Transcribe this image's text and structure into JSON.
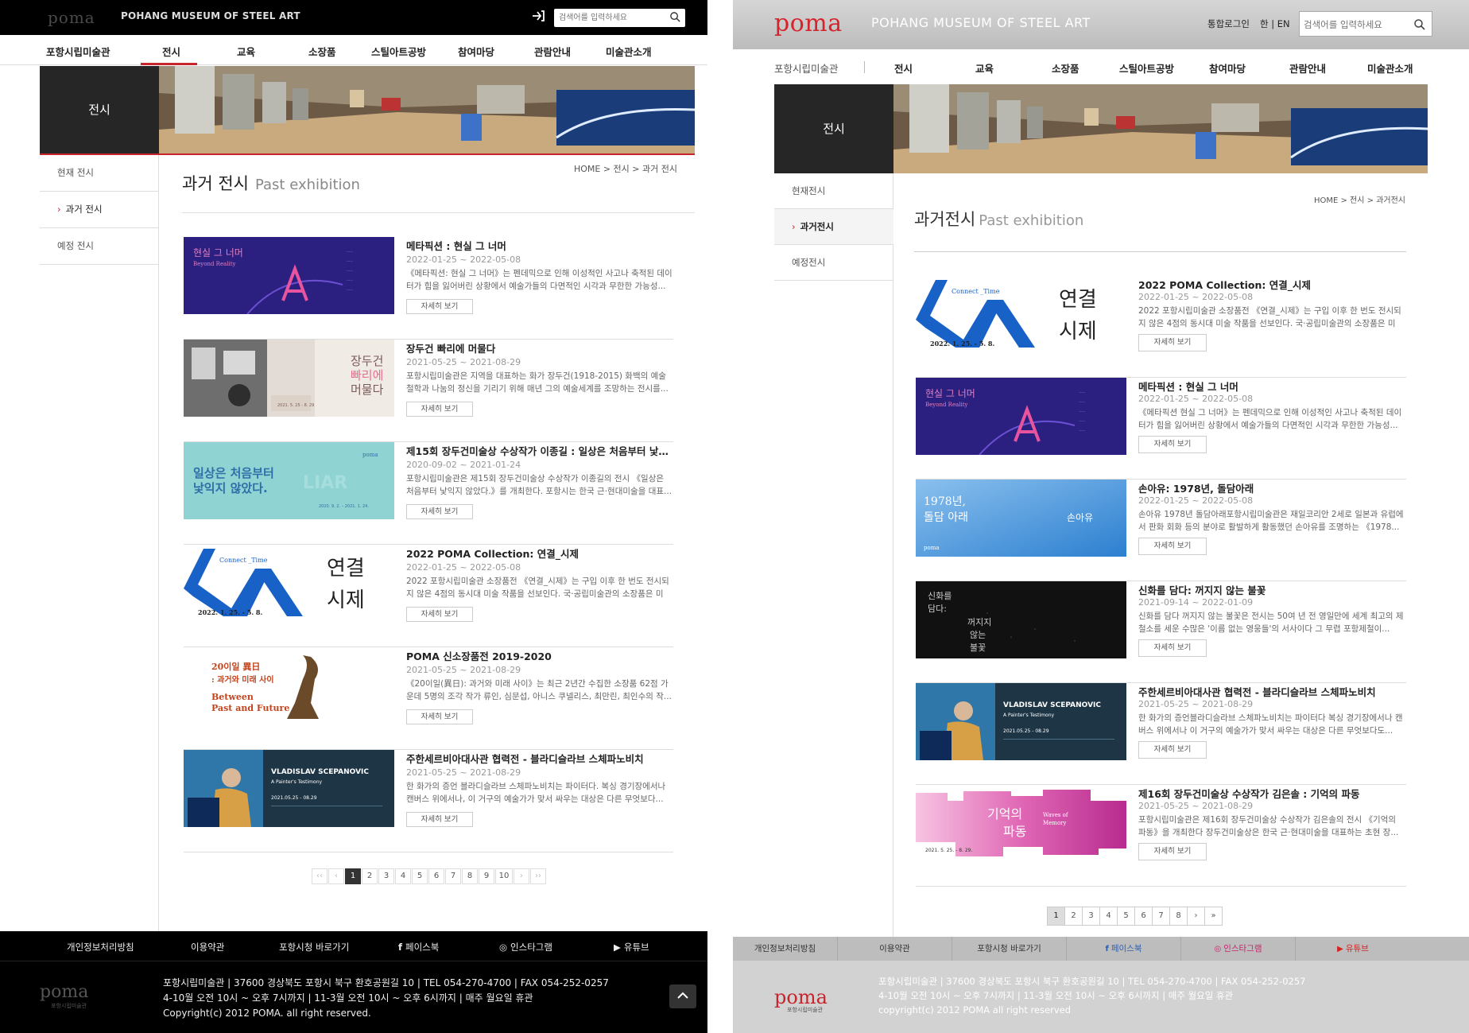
{
  "left": {
    "header": {
      "logo_word": "poma",
      "logo_text": "POHANG MUSEUM OF STEEL ART",
      "search_placeholder": "검색어를 입력하세요"
    },
    "nav": {
      "home": "포항시립미술관",
      "items": [
        "전시",
        "교육",
        "소장품",
        "스틸아트공방",
        "참여마당",
        "관람안내",
        "미술관소개"
      ]
    },
    "hero_title": "전시",
    "side": [
      "현재 전시",
      "과거 전시",
      "예정 전시"
    ],
    "breadcrumb": [
      "HOME",
      "전시",
      "과거 전시"
    ],
    "page_title": "과거 전시",
    "page_title_en": "Past exhibition",
    "more_label": "자세히 보기",
    "exhibitions": [
      {
        "title": "메타픽션 : 현실 그 너머",
        "date": "2022-01-25 ~ 2022-05-08",
        "desc": "《메타픽션: 현실 그 너머》는 펜데믹으로 인해 이성적인 사고나 축적된 데이터가 힘을 잃어버린 상황에서 예술가들의 다면적인 시각과 무한한 가능성..."
      },
      {
        "title": "장두건 빠리에 머물다",
        "date": "2021-05-25 ~ 2021-08-29",
        "desc": "포항시립미술관은 지역을 대표하는 화가 장두건(1918-2015) 화백의 예술철학과 나눔의 정신을 기리기 위해 매년 그의 예술세계를 조망하는 전시를..."
      },
      {
        "title": "제15회 장두건미술상 수상작가 이종길 : 일상은 처음부터 낯익지 않았다.",
        "date": "2020-09-02 ~ 2021-01-24",
        "desc": "포항시립미술관은 제15회 장두건미술상 수상작가 이종길의 전시 《일상은 처음부터 낯익지 않았다.》를 개최한다. 포항시는 한국 근·현대미술을 대표..."
      },
      {
        "title": "2022 POMA Collection: 연결_시제",
        "date": "2022-01-25 ~ 2022-05-08",
        "desc": "2022 포항시립미술관 소장품전 《연결_시제》는 구입 이후 한 번도 전시되지 않은 4점의 동시대 미술 작품을 선보인다. 국·공립미술관의 소장품은 미래..."
      },
      {
        "title": "POMA 신소장품전 2019-2020",
        "date": "2021-05-25 ~ 2021-08-29",
        "desc": "《20이일(異日): 과거와 미래 사이》는 최근 2년간 수집한 소장품 62점 가운데 5명의 조각 작가 류인, 심문섭, 아니스 쿠넬리스, 최만린, 최인수의 작..."
      },
      {
        "title": "주한세르비아대사관 협력전 - 블라디슬라브 스체파노비치",
        "date": "2021-05-25 ~ 2021-08-29",
        "desc": "한 화가의 증언 블라디슬라브 스체파노비치는 파이터다. 복싱 경기장에서나 캔버스 위에서나, 이 거구의 예술가가 맞서 싸우는 대상은 다른 무엇보다..."
      }
    ],
    "pagination": [
      "‹‹",
      "‹",
      "1",
      "2",
      "3",
      "4",
      "5",
      "6",
      "7",
      "8",
      "9",
      "10",
      "›",
      "››"
    ],
    "footer_nav": [
      "개인정보처리방침",
      "이용약관",
      "포항시청 바로가기",
      "페이스북",
      "인스타그램",
      "유튜브"
    ],
    "footer_lines": [
      "포항시립미술관   |   37600 경상북도 포항시 북구 환호공원길 10   |   TEL 054-270-4700   |   FAX 054-252-0257",
      "4-10월 오전 10시 ~ 오후 7시까지   |   11-3월 오전 10시 ~ 오후 6시까지   |   매주 월요일 휴관",
      "Copyright(c) 2012 POMA. all right reserved."
    ],
    "footer_logo": "poma",
    "footer_logo_sub": "포항시립미술관"
  },
  "right": {
    "header": {
      "logo_word": "poma",
      "logo_text": "POHANG MUSEUM OF STEEL ART",
      "login": "통합로그인",
      "lang": "한 | EN",
      "search_placeholder": "검색어를 입력하세요"
    },
    "nav": {
      "home": "포항시립미술관",
      "items": [
        "전시",
        "교육",
        "소장품",
        "스틸아트공방",
        "참여마당",
        "관람안내",
        "미술관소개"
      ]
    },
    "hero_title": "전시",
    "side": [
      "현재전시",
      "과거전시",
      "예정전시"
    ],
    "breadcrumb": [
      "HOME",
      "전시",
      "과거전시"
    ],
    "page_title": "과거전시",
    "page_title_en": "Past exhibition",
    "more_label": "자세히 보기",
    "exhibitions": [
      {
        "title": "2022 POMA Collection: 연결_시제",
        "date": "2022-01-25 ~ 2022-05-08",
        "desc": "2022 포항시립미술관 소장품전 《연결_시제》는 구입 이후 한 번도 전시되지 않은 4점의 동시대 미술 작품을 선보인다. 국·공립미술관의 소장품은 미래..."
      },
      {
        "title": "메타픽션 : 현실 그 너머",
        "date": "2022-01-25 ~ 2022-05-08",
        "desc": "《메타픽션 현실 그 너머》는 펜데믹으로 인해 이성적인 사고나 축적된 데이터가 힘을 잃어버린 상황에서 예술가들의 다면적인 시각과 무한한 가능성..."
      },
      {
        "title": "손아유: 1978년, 돌담아래",
        "date": "2022-01-25 ~ 2022-05-08",
        "desc": "손아유 1978년 돌담아래포항시립미술관은 재일코리안 2세로 일본과 유럽에서 판화 회화 등의 분야로 활발하게 활동했던 손아유를 조명하는 《1978..."
      },
      {
        "title": "신화를 담다: 꺼지지 않는 불꽃",
        "date": "2021-09-14 ~ 2022-01-09",
        "desc": "신화를 담다 꺼지지 않는 불꽃은 전시는 50여 년 전 영일만에 세계 최고의 제철소를 세운 수많은 '이름 없는 영웅들'의 서사이다 그 무렵 포항제철이..."
      },
      {
        "title": "주한세르비아대사관 협력전 - 블라디슬라브 스체파노비치",
        "date": "2021-05-25 ~ 2021-08-29",
        "desc": "한 화가의 증언블라디슬라브 스체파노비치는 파이터다 복싱 경기장에서나 캔버스 위에서나 이 거구의 예술가가 맞서 싸우는 대상은 다른 무엇보다도..."
      },
      {
        "title": "제16회 장두건미술상 수상작가 김은솔 : 기억의 파동",
        "date": "2021-05-25 ~ 2021-08-29",
        "desc": "포항시립미술관은 제16회 장두건미술상 수상작가 김은솔의 전시 《기억의 파동》을 개최한다 장두건미술상은 한국 근·현대미술을 대표하는 초현 장..."
      }
    ],
    "pagination": [
      "1",
      "2",
      "3",
      "4",
      "5",
      "6",
      "7",
      "8",
      "›",
      "»"
    ],
    "footer_nav": [
      "개인정보처리방침",
      "이용약관",
      "포항시청 바로가기",
      "페이스북",
      "인스타그램",
      "유튜브"
    ],
    "footer_lines": [
      "포항시립미술관   |   37600 경상북도 포항시 북구 환호공원길 10   |   TEL 054-270-4700   |   FAX 054-252-0257",
      "4-10월 오전 10시 ~ 오후 7시까지   |   11-3월 오전 10시 ~ 오후 6시까지   |   매주 월요일 휴관",
      "copyright(c) 2012 POMA all right reserved"
    ],
    "footer_logo": "poma",
    "footer_logo_sub": "포항시립미술관"
  },
  "thumb_text": {
    "meta": [
      "현실 그 너머",
      "Beyond Reality"
    ],
    "jang": [
      "장두건",
      "빠리에",
      "머물다",
      "2021. 5. 25 - 8. 29"
    ],
    "lee": [
      "일상은 처음부터",
      "낯익지 않았다.",
      "2020. 9. 2. – 2021. 1. 24."
    ],
    "conn": [
      "연결",
      "시제",
      "Connect _Time",
      "2022. 1. 25. - 5. 8."
    ],
    "poma": [
      "20이일 異日",
      ": 과거와 미래 사이",
      "Between",
      "Past and Future"
    ],
    "vlad": [
      "VLADISLAV SCEPANOVIC",
      "A Painter's Testimony",
      "2021.05.25 - 08.29"
    ],
    "son": [
      "1978년,",
      "돌담 아래",
      "손아유"
    ],
    "myth": [
      "신화를",
      "담다:",
      "꺼지지",
      "않는",
      "불꽃"
    ],
    "kim": [
      "기억의",
      "파동",
      "Waves of",
      "Memory",
      "2021. 5. 25. - 8. 29."
    ]
  },
  "colors": {
    "accent": "#c8242c",
    "brand_red": "#d5242c",
    "dark": "#262626"
  }
}
